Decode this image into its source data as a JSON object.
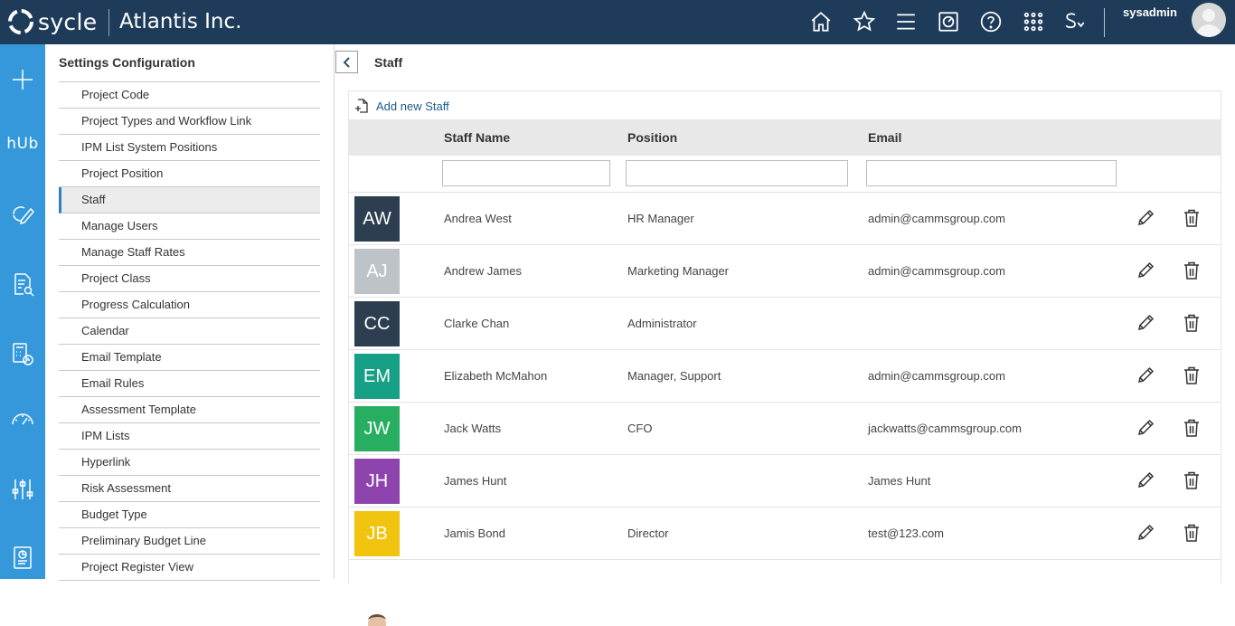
{
  "header": {
    "logo_text": "sycle",
    "company": "Atlantis Inc.",
    "username": "sysadmin",
    "icons": [
      "home-icon",
      "star-icon",
      "menu-icon",
      "dashboard-icon",
      "help-icon",
      "apps-grid-icon",
      "s-dropdown-icon"
    ]
  },
  "rail": {
    "hub_label": "hUb",
    "icons": [
      "plus-icon",
      "hub-icon",
      "cycle-edit-icon",
      "report-search-icon",
      "calculator-clock-icon",
      "gauge-icon",
      "sliders-icon",
      "document-chart-icon"
    ]
  },
  "settings": {
    "title": "Settings Configuration",
    "items": [
      {
        "label": "Project Code"
      },
      {
        "label": "Project Types and Workflow Link"
      },
      {
        "label": "IPM List System Positions"
      },
      {
        "label": "Project Position"
      },
      {
        "label": "Staff",
        "active": true
      },
      {
        "label": "Manage Users"
      },
      {
        "label": "Manage Staff Rates"
      },
      {
        "label": "Project Class"
      },
      {
        "label": "Progress Calculation"
      },
      {
        "label": "Calendar"
      },
      {
        "label": "Email Template"
      },
      {
        "label": "Email Rules"
      },
      {
        "label": "Assessment Template"
      },
      {
        "label": "IPM Lists"
      },
      {
        "label": "Hyperlink"
      },
      {
        "label": "Risk Assessment"
      },
      {
        "label": "Budget Type"
      },
      {
        "label": "Preliminary Budget Line"
      },
      {
        "label": "Project Register View"
      }
    ]
  },
  "main": {
    "title": "Staff",
    "add_label": "Add new Staff",
    "columns": {
      "name": "Staff Name",
      "position": "Position",
      "email": "Email"
    },
    "filters": {
      "name": "",
      "position": "",
      "email": ""
    },
    "rows": [
      {
        "initials": "AW",
        "color": "#2c3e50",
        "name": "Andrea West",
        "position": "HR Manager",
        "email": "admin@cammsgroup.com"
      },
      {
        "initials": "AJ",
        "color": "#bdc3c7",
        "name": "Andrew James",
        "position": "Marketing Manager",
        "email": "admin@cammsgroup.com"
      },
      {
        "initials": "CC",
        "color": "#2c3e50",
        "name": "Clarke Chan",
        "position": "Administrator",
        "email": ""
      },
      {
        "initials": "EM",
        "color": "#16a085",
        "name": "Elizabeth McMahon",
        "position": "Manager, Support",
        "email": "admin@cammsgroup.com"
      },
      {
        "initials": "JW",
        "color": "#27ae60",
        "name": "Jack Watts",
        "position": "CFO",
        "email": "jackwatts@cammsgroup.com"
      },
      {
        "initials": "JH",
        "color": "#8e44ad",
        "name": "James Hunt",
        "position": "",
        "email": "James Hunt"
      },
      {
        "initials": "JB",
        "color": "#f1c40f",
        "name": "Jamis Bond",
        "position": "Director",
        "email": "test@123.com"
      }
    ]
  }
}
